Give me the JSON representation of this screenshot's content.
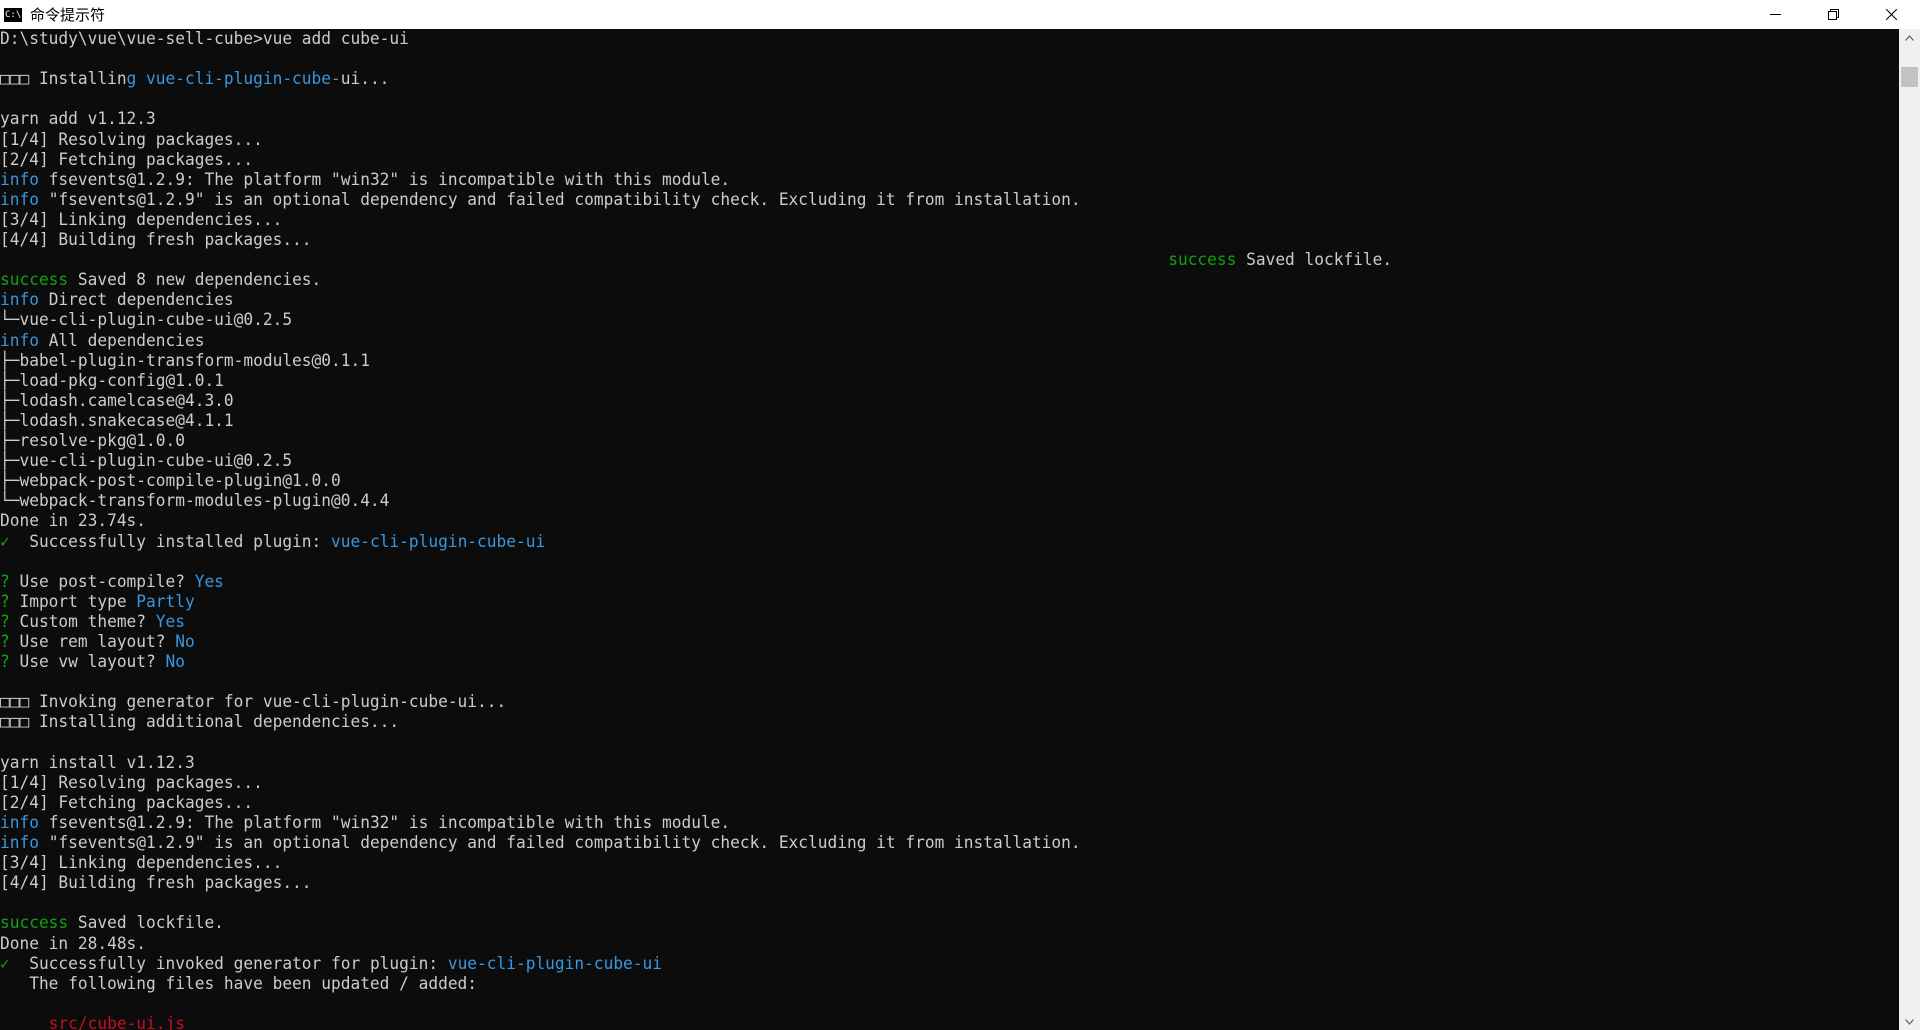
{
  "window": {
    "title": "命令提示符",
    "icon_label": "C:\\",
    "controls": [
      "minimize-icon",
      "restore-icon",
      "close-icon"
    ]
  },
  "console": {
    "lines": [
      [
        {
          "t": "D:\\study\\vue\\vue-sell-cube>vue add cube-ui",
          "c": ""
        }
      ],
      [],
      [
        {
          "t": "□□□ Installin",
          "c": ""
        },
        {
          "t": "g vue-cli-plugin-cube-",
          "c": "blue"
        },
        {
          "t": "ui...",
          "c": ""
        }
      ],
      [],
      [
        {
          "t": "yarn add v1.12.3",
          "c": ""
        }
      ],
      [
        {
          "t": "[1/4] Resolving packages...",
          "c": ""
        }
      ],
      [
        {
          "t": "[2/4] Fetching packages...",
          "c": ""
        }
      ],
      [
        {
          "t": "info",
          "c": "blue"
        },
        {
          "t": " fsevents@1.2.9: The platform \"win32\" is incompatible with this module.",
          "c": ""
        }
      ],
      [
        {
          "t": "info",
          "c": "blue"
        },
        {
          "t": " \"fsevents@1.2.9\" is an optional dependency and failed compatibility check. Excluding it from installation.",
          "c": ""
        }
      ],
      [
        {
          "t": "[3/4] Linking dependencies...",
          "c": ""
        }
      ],
      [
        {
          "t": "[4/4] Building fresh packages...",
          "c": ""
        }
      ],
      [
        {
          "t": "                                                                                                                        ",
          "c": ""
        },
        {
          "t": "success",
          "c": "green"
        },
        {
          "t": " Saved lockfile.",
          "c": ""
        }
      ],
      [
        {
          "t": "success",
          "c": "green"
        },
        {
          "t": " Saved 8 new dependencies.",
          "c": ""
        }
      ],
      [
        {
          "t": "info",
          "c": "blue"
        },
        {
          "t": " Direct dependencies",
          "c": ""
        }
      ],
      [
        {
          "t": "└─vue-cli-plugin-cube-ui@0.2.5",
          "c": ""
        }
      ],
      [
        {
          "t": "info",
          "c": "blue"
        },
        {
          "t": " All dependencies",
          "c": ""
        }
      ],
      [
        {
          "t": "├─babel-plugin-transform-modules@0.1.1",
          "c": ""
        }
      ],
      [
        {
          "t": "├─load-pkg-config@1.0.1",
          "c": ""
        }
      ],
      [
        {
          "t": "├─lodash.camelcase@4.3.0",
          "c": ""
        }
      ],
      [
        {
          "t": "├─lodash.snakecase@4.1.1",
          "c": ""
        }
      ],
      [
        {
          "t": "├─resolve-pkg@1.0.0",
          "c": ""
        }
      ],
      [
        {
          "t": "├─vue-cli-plugin-cube-ui@0.2.5",
          "c": ""
        }
      ],
      [
        {
          "t": "├─webpack-post-compile-plugin@1.0.0",
          "c": ""
        }
      ],
      [
        {
          "t": "└─webpack-transform-modules-plugin@0.4.4",
          "c": ""
        }
      ],
      [
        {
          "t": "Done in 23.74s.",
          "c": ""
        }
      ],
      [
        {
          "t": "✓",
          "c": "green"
        },
        {
          "t": "  Successfully installed plugin: ",
          "c": ""
        },
        {
          "t": "vue-cli-plugin-cube-ui",
          "c": "blue"
        }
      ],
      [],
      [
        {
          "t": "?",
          "c": "green"
        },
        {
          "t": " Use post-compile? ",
          "c": ""
        },
        {
          "t": "Yes",
          "c": "blue"
        }
      ],
      [
        {
          "t": "?",
          "c": "green"
        },
        {
          "t": " Import type ",
          "c": ""
        },
        {
          "t": "Partly",
          "c": "blue"
        }
      ],
      [
        {
          "t": "?",
          "c": "green"
        },
        {
          "t": " Custom theme? ",
          "c": ""
        },
        {
          "t": "Yes",
          "c": "blue"
        }
      ],
      [
        {
          "t": "?",
          "c": "green"
        },
        {
          "t": " Use rem layout? ",
          "c": ""
        },
        {
          "t": "No",
          "c": "blue"
        }
      ],
      [
        {
          "t": "?",
          "c": "green"
        },
        {
          "t": " Use vw layout? ",
          "c": ""
        },
        {
          "t": "No",
          "c": "blue"
        }
      ],
      [],
      [
        {
          "t": "□□□ Invoking generator for vue-cli-plugin-cube-ui...",
          "c": ""
        }
      ],
      [
        {
          "t": "□□□ Installing additional dependencies...",
          "c": ""
        }
      ],
      [],
      [
        {
          "t": "yarn install v1.12.3",
          "c": ""
        }
      ],
      [
        {
          "t": "[1/4] Resolving packages...",
          "c": ""
        }
      ],
      [
        {
          "t": "[2/4] Fetching packages...",
          "c": ""
        }
      ],
      [
        {
          "t": "info",
          "c": "blue"
        },
        {
          "t": " fsevents@1.2.9: The platform \"win32\" is incompatible with this module.",
          "c": ""
        }
      ],
      [
        {
          "t": "info",
          "c": "blue"
        },
        {
          "t": " \"fsevents@1.2.9\" is an optional dependency and failed compatibility check. Excluding it from installation.",
          "c": ""
        }
      ],
      [
        {
          "t": "[3/4] Linking dependencies...",
          "c": ""
        }
      ],
      [
        {
          "t": "[4/4] Building fresh packages...",
          "c": ""
        }
      ],
      [],
      [
        {
          "t": "success",
          "c": "green"
        },
        {
          "t": " Saved lockfile.",
          "c": ""
        }
      ],
      [
        {
          "t": "Done in 28.48s.",
          "c": ""
        }
      ],
      [
        {
          "t": "✓",
          "c": "green"
        },
        {
          "t": "  Successfully invoked generator for plugin: ",
          "c": ""
        },
        {
          "t": "vue-cli-plugin-cube-ui",
          "c": "blue"
        }
      ],
      [
        {
          "t": "   The following files have been updated / added:",
          "c": ""
        }
      ],
      [],
      [
        {
          "t": "     src/cube-ui.js",
          "c": "red"
        }
      ]
    ]
  },
  "scrollbar": {
    "up_icon": "chevron-up-icon",
    "down_icon": "chevron-down-icon"
  },
  "colors": {
    "background": "#0c0c0c",
    "text": "#cccccc",
    "blue": "#3a96dd",
    "green": "#13a10e",
    "red": "#c50f1f"
  }
}
